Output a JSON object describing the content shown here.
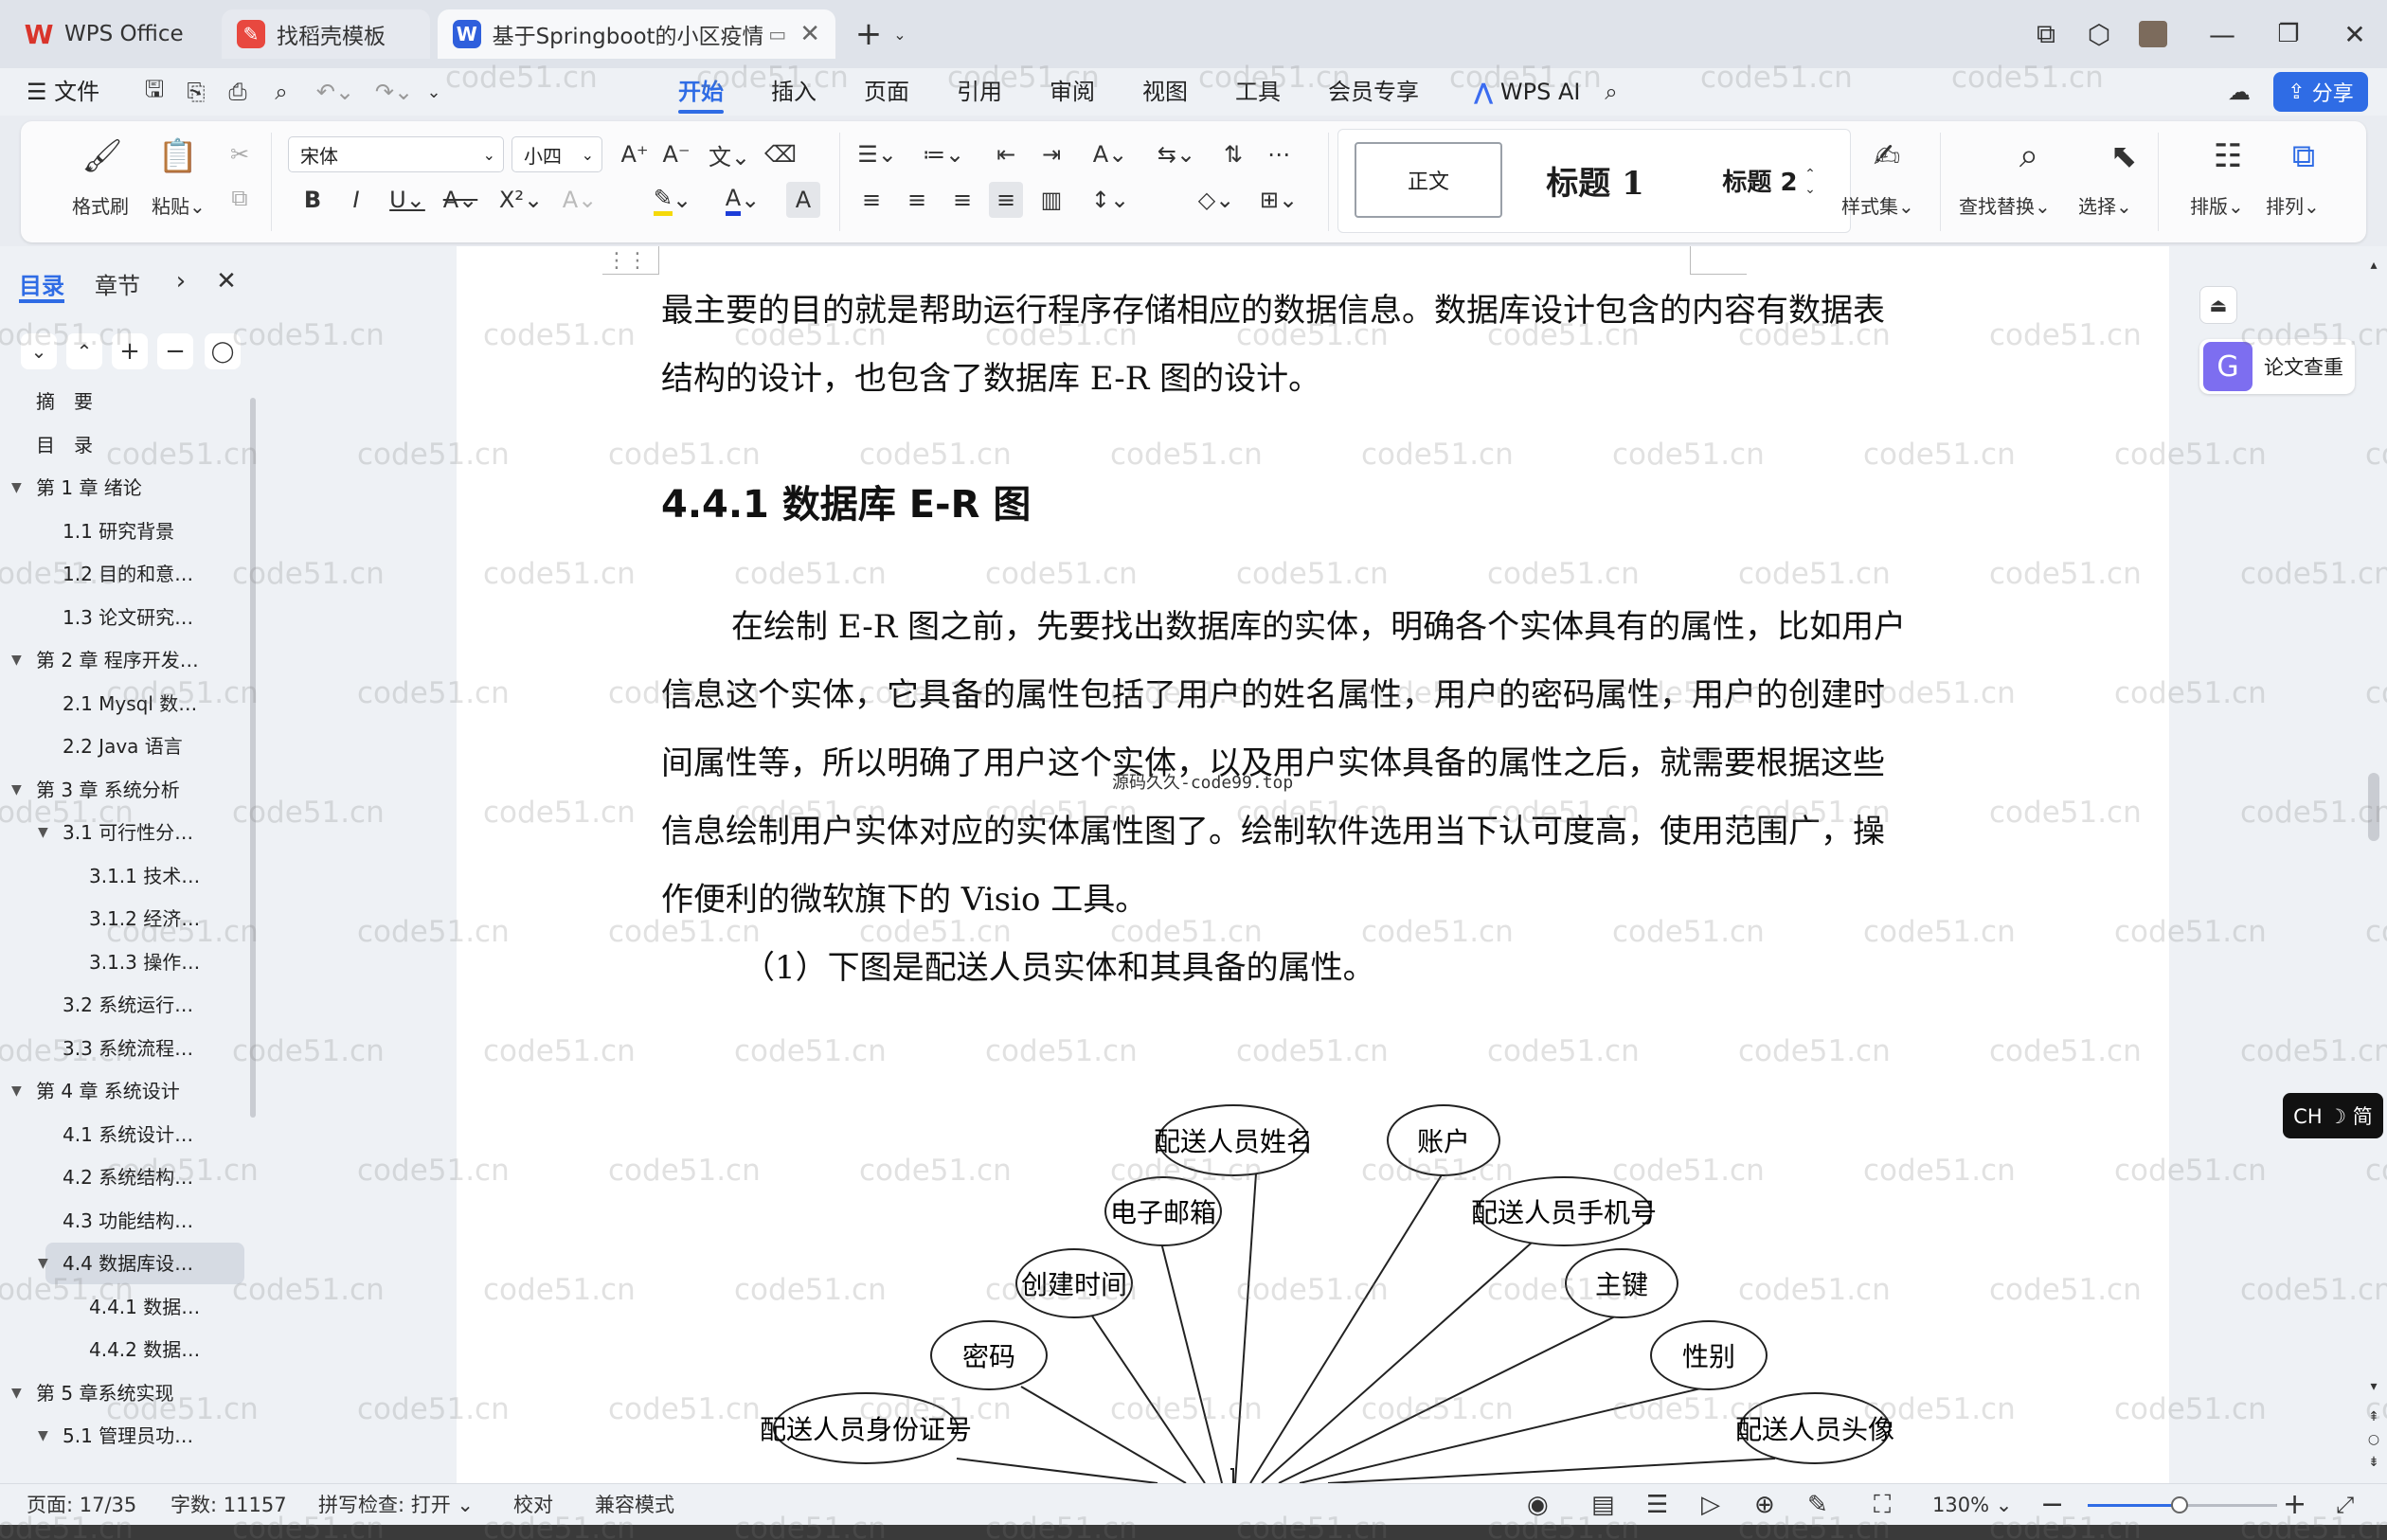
{
  "tabs": [
    {
      "label": "WPS Office",
      "icon": "wps-logo-icon",
      "color": "#d9342b"
    },
    {
      "label": "找稻壳模板",
      "icon": "docer-icon",
      "color": "#e8483f"
    },
    {
      "label": "基于Springboot的小区疫情购",
      "icon": "word-doc-icon",
      "color": "#2f5fdc"
    }
  ],
  "menu": {
    "file": "文件",
    "items": [
      "开始",
      "插入",
      "页面",
      "引用",
      "审阅",
      "视图",
      "工具",
      "会员专享"
    ],
    "active": "开始",
    "wps_ai": "WPS AI",
    "share": "分享"
  },
  "ribbon": {
    "format_painter": "格式刷",
    "paste": "粘贴",
    "font_name": "宋体",
    "font_size": "小四",
    "styles": {
      "normal": "正文",
      "heading1": "标题 1",
      "heading2": "标题 2"
    },
    "style_set": "样式集",
    "find_replace": "查找替换",
    "select": "选择",
    "layout": "排版",
    "arrange": "排列"
  },
  "sidebar": {
    "tab_toc": "目录",
    "tab_chapter": "章节",
    "items": [
      {
        "label": "摘　要",
        "level": 0,
        "arrow": ""
      },
      {
        "label": "目　录",
        "level": 0,
        "arrow": ""
      },
      {
        "label": "第 1 章  绪论",
        "level": 0,
        "arrow": "▼"
      },
      {
        "label": "1.1  研究背景",
        "level": 1,
        "arrow": ""
      },
      {
        "label": "1.2 目的和意…",
        "level": 1,
        "arrow": ""
      },
      {
        "label": "1.3  论文研究…",
        "level": 1,
        "arrow": ""
      },
      {
        "label": "第 2 章  程序开发…",
        "level": 0,
        "arrow": "▼"
      },
      {
        "label": "2.1 Mysql 数…",
        "level": 1,
        "arrow": ""
      },
      {
        "label": "2.2 Java 语言",
        "level": 1,
        "arrow": ""
      },
      {
        "label": "第 3 章  系统分析",
        "level": 0,
        "arrow": "▼"
      },
      {
        "label": "3.1 可行性分…",
        "level": 1,
        "arrow": "▼"
      },
      {
        "label": "3.1.1  技术…",
        "level": 2,
        "arrow": ""
      },
      {
        "label": "3.1.2  经济…",
        "level": 2,
        "arrow": ""
      },
      {
        "label": "3.1.3  操作…",
        "level": 2,
        "arrow": ""
      },
      {
        "label": "3.2 系统运行…",
        "level": 1,
        "arrow": ""
      },
      {
        "label": "3.3 系统流程…",
        "level": 1,
        "arrow": ""
      },
      {
        "label": "第 4 章  系统设计",
        "level": 0,
        "arrow": "▼"
      },
      {
        "label": "4.1  系统设计…",
        "level": 1,
        "arrow": ""
      },
      {
        "label": "4.2  系统结构…",
        "level": 1,
        "arrow": ""
      },
      {
        "label": "4.3 功能结构…",
        "level": 1,
        "arrow": ""
      },
      {
        "label": "4.4 数据库设…",
        "level": 1,
        "arrow": "▼",
        "selected": true
      },
      {
        "label": "4.4.1  数据…",
        "level": 2,
        "arrow": ""
      },
      {
        "label": "4.4.2  数据…",
        "level": 2,
        "arrow": ""
      },
      {
        "label": "第 5 章系统实现",
        "level": 0,
        "arrow": "▼"
      },
      {
        "label": "5.1 管理员功…",
        "level": 1,
        "arrow": "▼"
      }
    ]
  },
  "doc": {
    "lines": [
      "最主要的目的就是帮助运行程序存储相应的数据信息。数据库设计包含的内容有数据表",
      "结构的设计，也包含了数据库 E-R 图的设计。"
    ],
    "heading": "4.4.1  数据库 E-R 图",
    "para": [
      "在绘制 E-R 图之前，先要找出数据库的实体，明确各个实体具有的属性，比如用户",
      "信息这个实体，它具备的属性包括了用户的姓名属性，用户的密码属性，用户的创建时",
      "间属性等，所以明确了用户这个实体，以及用户实体具备的属性之后，就需要根据这些",
      "信息绘制用户实体对应的实体属性图了。绘制软件选用当下认可度高，使用范围广，操",
      "作便利的微软旗下的 Visio 工具。"
    ],
    "overlay_mark": "源码久久-code99.top",
    "caption": "（1）下图是配送人员实体和其具备的属性。",
    "er_attributes": [
      "配送人员姓名",
      "账户",
      "电子邮箱",
      "配送人员手机号",
      "创建时间",
      "主键",
      "密码",
      "性别",
      "配送人员身份证号",
      "配送人员头像"
    ]
  },
  "right_panel": {
    "thesis_check": "论文查重",
    "ime": "CH ☽ 简"
  },
  "status": {
    "page": "页面: 17/35",
    "words": "字数: 11157",
    "spell": "拼写检查: 打开",
    "proof": "校对",
    "compat": "兼容模式",
    "zoom": "130%"
  },
  "watermark": "code51.cn",
  "colors": {
    "accent": "#2f6ce5",
    "share_bg": "#2f6ce5"
  }
}
